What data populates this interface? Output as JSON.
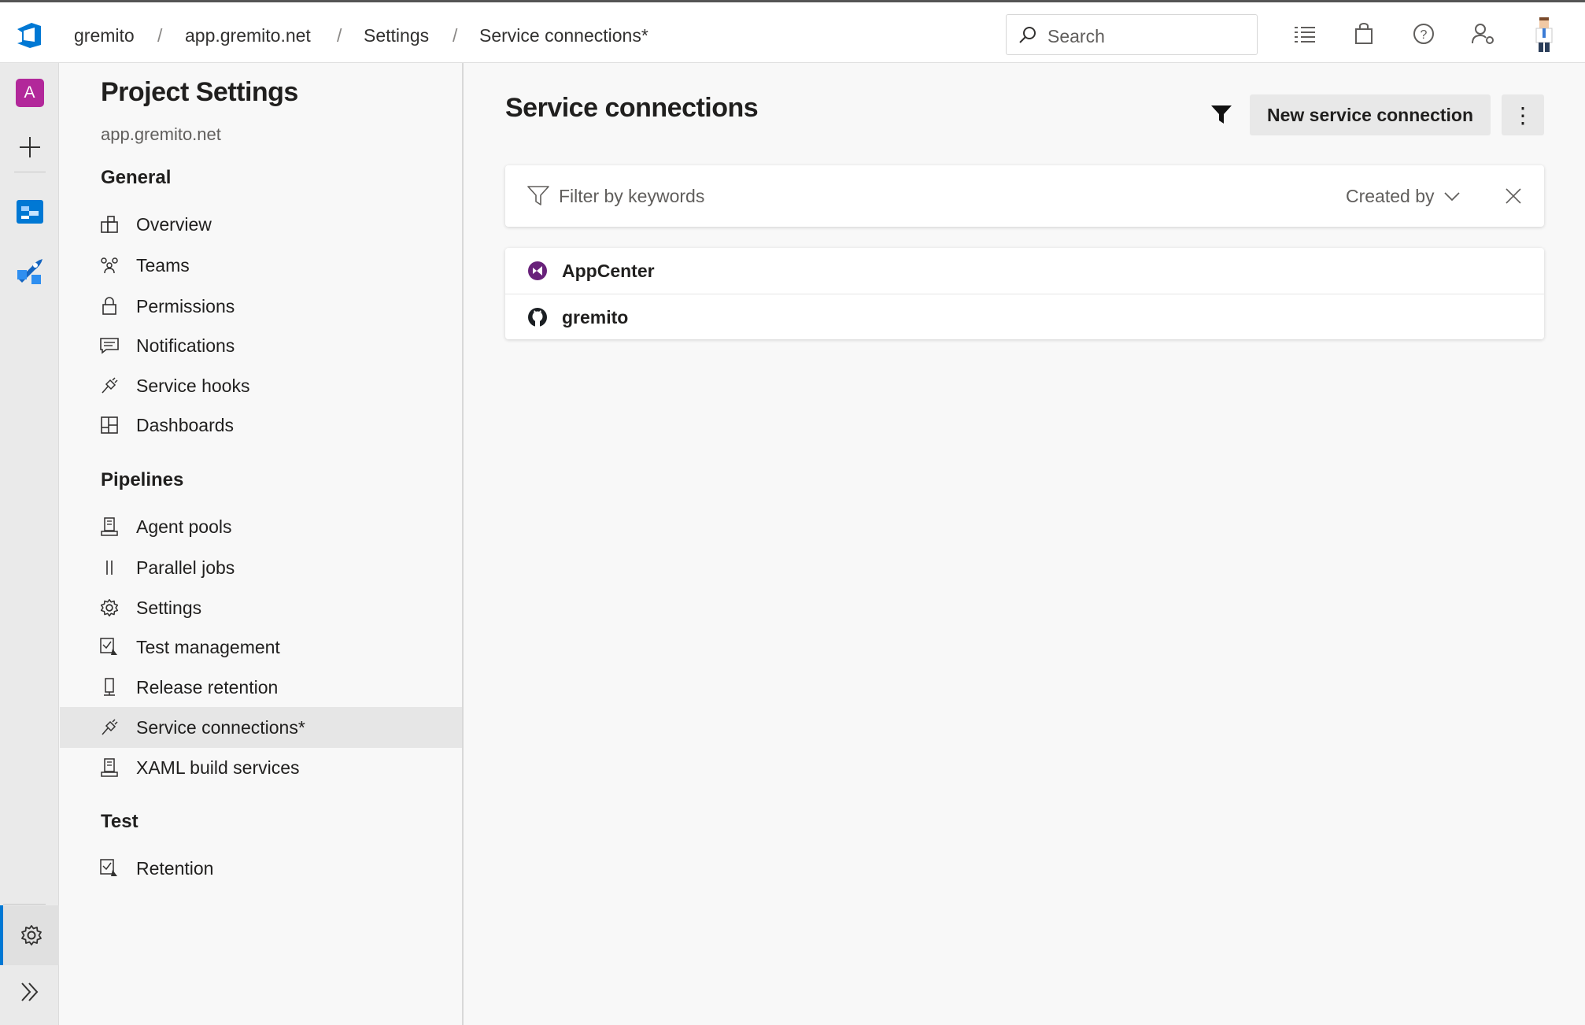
{
  "header": {
    "breadcrumbs": [
      "gremito",
      "app.gremito.net",
      "Settings",
      "Service connections*"
    ],
    "search_placeholder": "Search",
    "icons": [
      "azure-devops-logo-icon",
      "task-list-icon",
      "shopping-bag-icon",
      "help-icon",
      "user-settings-icon",
      "user-avatar-icon"
    ]
  },
  "rail": {
    "project_initial": "A",
    "project_color": "#b2289a",
    "accent": "#0078d4",
    "icons": [
      "plus-icon",
      "boards-icon",
      "pipelines-icon",
      "gear-icon",
      "expand-icon"
    ]
  },
  "nav": {
    "title": "Project Settings",
    "subtitle": "app.gremito.net",
    "sections": [
      {
        "title": "General",
        "items": [
          {
            "label": "Overview",
            "icon": "overview-icon"
          },
          {
            "label": "Teams",
            "icon": "teams-icon"
          },
          {
            "label": "Permissions",
            "icon": "lock-icon"
          },
          {
            "label": "Notifications",
            "icon": "comment-icon"
          },
          {
            "label": "Service hooks",
            "icon": "plug-icon"
          },
          {
            "label": "Dashboards",
            "icon": "dashboard-icon"
          }
        ]
      },
      {
        "title": "Pipelines",
        "items": [
          {
            "label": "Agent pools",
            "icon": "agent-icon"
          },
          {
            "label": "Parallel jobs",
            "icon": "parallel-icon"
          },
          {
            "label": "Settings",
            "icon": "gear-icon"
          },
          {
            "label": "Test management",
            "icon": "test-icon"
          },
          {
            "label": "Release retention",
            "icon": "phone-icon"
          },
          {
            "label": "Service connections*",
            "icon": "plug-icon",
            "active": true
          },
          {
            "label": "XAML build services",
            "icon": "agent-icon"
          }
        ]
      },
      {
        "title": "Test",
        "items": [
          {
            "label": "Retention",
            "icon": "test-icon"
          }
        ]
      }
    ]
  },
  "main": {
    "title": "Service connections",
    "new_button": "New service connection",
    "more_button": "⋮",
    "filter": {
      "placeholder": "Filter by keywords",
      "created_by": "Created by"
    },
    "connections": [
      {
        "name": "AppCenter",
        "icon": "visual-studio-icon",
        "color": "#68217a"
      },
      {
        "name": "gremito",
        "icon": "github-icon",
        "color": "#1b1f23"
      }
    ]
  }
}
